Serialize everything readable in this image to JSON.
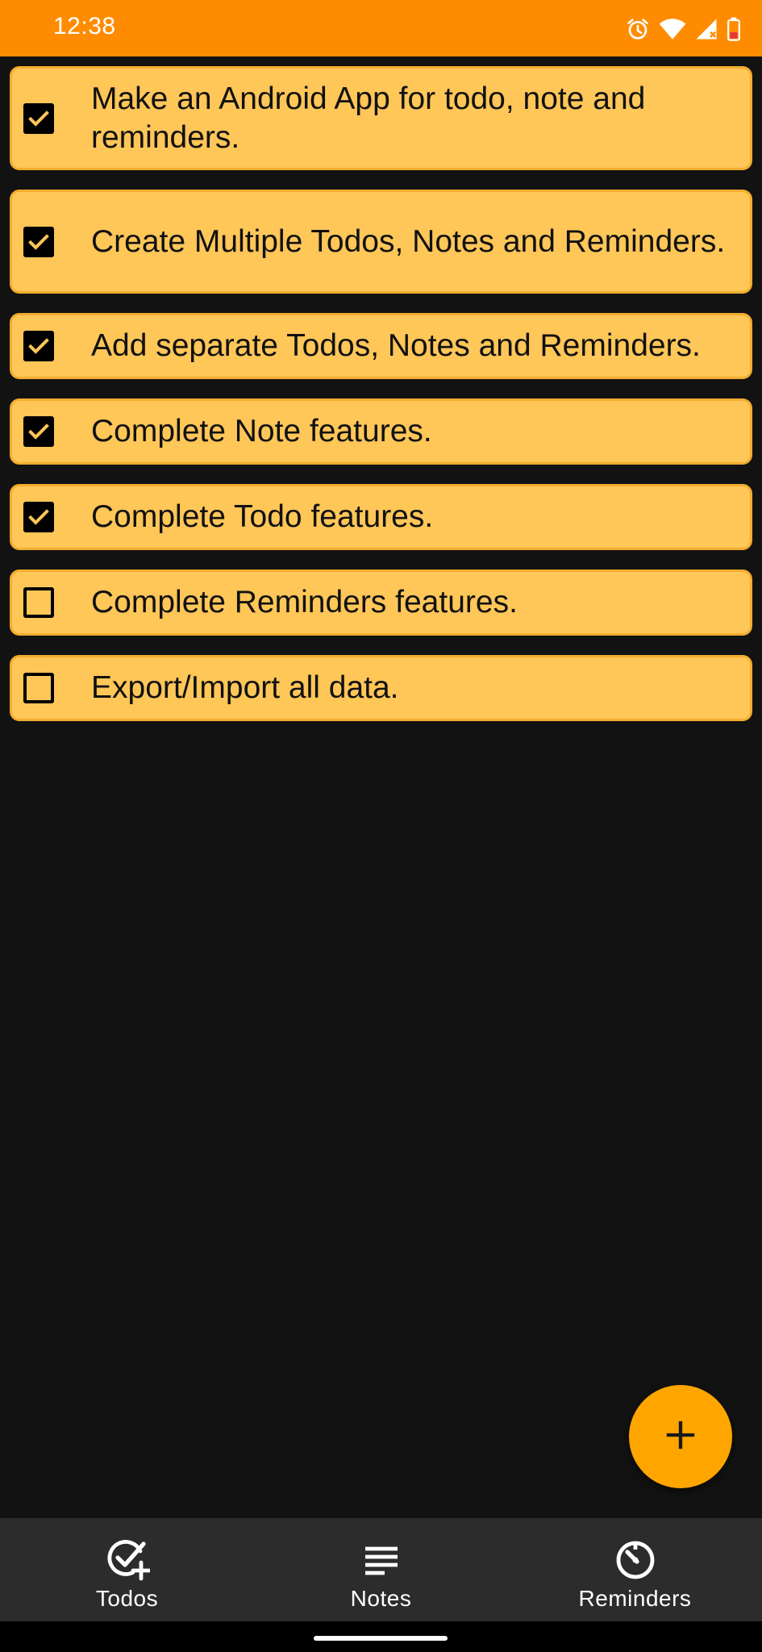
{
  "status_bar": {
    "time": "12:38",
    "background": "#ff8c00",
    "icons": [
      "alarm-icon",
      "wifi-icon",
      "cellular-signal-icon",
      "battery-low-icon"
    ]
  },
  "todos": [
    {
      "text": "Make an Android App for todo, note and reminders.",
      "checked": true
    },
    {
      "text": "Create Multiple Todos, Notes and Reminders.",
      "checked": true
    },
    {
      "text": "Add separate Todos, Notes and Reminders.",
      "checked": true
    },
    {
      "text": "Complete Note features.",
      "checked": true
    },
    {
      "text": "Complete Todo features.",
      "checked": true
    },
    {
      "text": "Complete Reminders features.",
      "checked": false
    },
    {
      "text": "Export/Import all data.",
      "checked": false
    }
  ],
  "fab": {
    "icon": "plus-icon",
    "color": "#ffa500"
  },
  "bottom_nav": {
    "items": [
      {
        "label": "Todos",
        "icon": "check-circle-add-icon"
      },
      {
        "label": "Notes",
        "icon": "notes-lines-icon"
      },
      {
        "label": "Reminders",
        "icon": "timer-icon"
      }
    ]
  },
  "colors": {
    "card_background": "#ffc658",
    "card_border": "#f2ad2e",
    "page_background": "#121212",
    "nav_background": "#2c2c2c"
  }
}
